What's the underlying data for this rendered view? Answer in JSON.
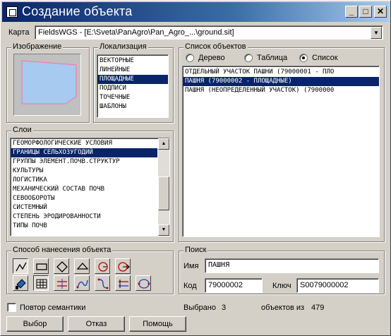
{
  "window": {
    "title": "Создание объекта"
  },
  "map": {
    "label": "Карта",
    "value": "FieldsWGS - [E:\\Sveta\\PanAgro\\Pan_Agro_...\\ground.sit]"
  },
  "image_group": {
    "title": "Изображение"
  },
  "localization": {
    "title": "Локализация",
    "items": [
      "ВЕКТОРНЫЕ",
      "ЛИНЕЙНЫЕ",
      "ПЛОЩАДНЫЕ",
      "ПОДПИСИ",
      "ТОЧЕЧНЫЕ",
      "ШАБЛОНЫ"
    ],
    "selected_index": 2
  },
  "object_list": {
    "title": "Список объектов",
    "view_modes": [
      "Дерево",
      "Таблица",
      "Список"
    ],
    "selected_mode": "Список",
    "items": [
      "ОТДЕЛЬНЫЙ УЧАСТОК ПАШНИ (79000001 - ПЛО",
      "ПАШНЯ (79000002 - ПЛОЩАДНЫЕ)",
      "ПАШНЯ (НЕОПРЕДЕЛЕННЫЙ УЧАСТОК) (7900000"
    ],
    "selected_index": 1
  },
  "layers": {
    "title": "Слои",
    "items": [
      "ГЕОМОРФОЛОГИЧЕСКИЕ УСЛОВИЯ",
      "ГРАНИЦЫ СЕЛЬХОЗУГОДИЙ",
      "ГРУППЫ ЭЛЕМЕНТ.ПОЧВ.СТРУКТУР",
      "КУЛЬТУРЫ",
      "ЛОГИСТИКА",
      "МЕХАНИЧЕСКИЙ СОСТАВ ПОЧВ",
      "СЕВООБОРОТЫ",
      "СИСТЕМНЫЙ",
      "СТЕПЕНЬ ЭРОДИРОВАННОСТИ",
      "ТИПЫ ПОЧВ"
    ],
    "selected_index": 1
  },
  "method": {
    "title": "Способ нанесения объекта"
  },
  "search": {
    "title": "Поиск",
    "name_label": "Имя",
    "name_value": "ПАШНЯ",
    "code_label": "Код",
    "code_value": "79000002",
    "key_label": "Ключ",
    "key_value": "S0079000002"
  },
  "repeat_semantics": {
    "label": "Повтор семантики",
    "checked": false
  },
  "status": {
    "selected_label": "Выбрано",
    "selected_count": "3",
    "total_label": "объектов из",
    "total_count": "479"
  },
  "buttons": {
    "select": "Выбор",
    "cancel": "Отказ",
    "help": "Помощь"
  },
  "colors": {
    "titlebar_start": "#0a246a",
    "titlebar_end": "#a6caf0",
    "selection": "#0a246a",
    "preview_fill": "#a6caf0"
  }
}
